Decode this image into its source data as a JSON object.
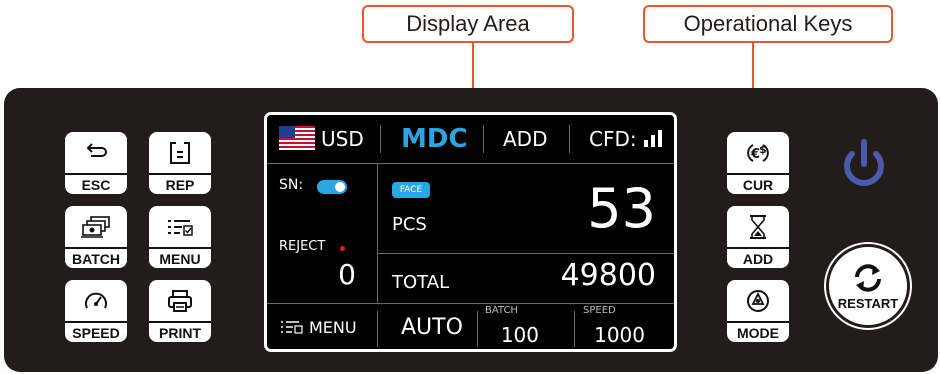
{
  "callouts": {
    "display_area": "Display Area",
    "operational_keys": "Operational Keys"
  },
  "colors": {
    "accent_orange": "#e9572f",
    "panel": "#231c1a",
    "screen_accent_blue": "#2aa6e2",
    "power_blue": "#4a5bab",
    "reject_dot": "#e02020"
  },
  "left_keys": [
    {
      "label": "ESC",
      "icon": "return-arrow-icon"
    },
    {
      "label": "REP",
      "icon": "report-document-icon"
    },
    {
      "label": "BATCH",
      "icon": "cash-stack-icon"
    },
    {
      "label": "MENU",
      "icon": "menu-list-icon"
    },
    {
      "label": "SPEED",
      "icon": "speedometer-icon"
    },
    {
      "label": "PRINT",
      "icon": "printer-icon"
    }
  ],
  "right_keys": [
    {
      "label": "CUR",
      "icon": "currency-exchange-icon"
    },
    {
      "label": "ADD",
      "icon": "hourglass-icon"
    },
    {
      "label": "MODE",
      "icon": "mode-dial-icon"
    }
  ],
  "restart": {
    "label": "RESTART",
    "icon": "refresh-icon"
  },
  "power": {
    "icon": "power-icon"
  },
  "display": {
    "currency": "USD",
    "currency_flag": "us-flag-icon",
    "mode": "MDC",
    "add_label": "ADD",
    "cfd_label": "CFD:",
    "cfd_icon": "signal-bars-icon",
    "sn_label": "SN:",
    "sn_toggle": "on",
    "face_badge": "FACE",
    "pcs_label": "PCS",
    "pcs_value": "53",
    "reject_label": "REJECT",
    "reject_value": "0",
    "total_label": "TOTAL",
    "total_value": "49800",
    "menu_label": "MENU",
    "auto_label": "AUTO",
    "batch_label": "BATCH",
    "batch_value": "100",
    "speed_label": "SPEED",
    "speed_value": "1000"
  }
}
